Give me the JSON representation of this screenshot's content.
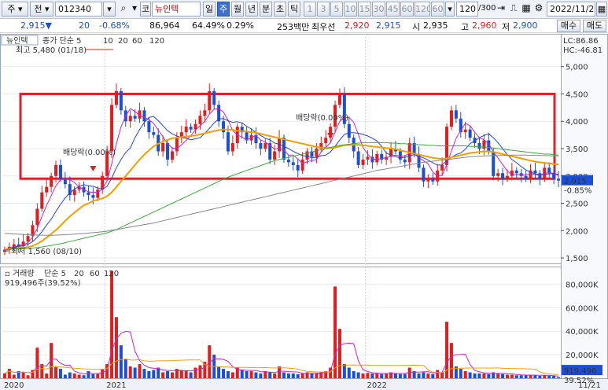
{
  "toolbar": {
    "market": "주",
    "market2": "전",
    "code": "012340",
    "name_prefix": "코",
    "name": "뉴인텍",
    "periods": [
      "일",
      "주",
      "월",
      "년",
      "분",
      "초",
      "틱"
    ],
    "active_period": "주",
    "intervals": [
      "1",
      "3",
      "5",
      "10",
      "15",
      "30",
      "45",
      "60",
      "120",
      "60"
    ],
    "count": "120",
    "total": "/300",
    "date": "2022/11/21",
    "buy_label": "매수",
    "sell_label": "매도"
  },
  "quote": {
    "price": "2,915▼",
    "change": "20",
    "change_pct": "-0.68%",
    "volume": "86,964",
    "vol_ratio": "64.49%",
    "turnover": "0.29%",
    "amount": "253백만",
    "best_ask_label": "최우선",
    "best_ask": "2,920",
    "best_bid": "2,915",
    "open_label": "시",
    "open": "2,935",
    "high_label": "고",
    "high": "2,960",
    "low_label": "저",
    "low": "2,900"
  },
  "colors": {
    "up": "#e01e1e",
    "down": "#1a4fd6",
    "ma5": "#cc22cc",
    "ma10": "#2244dd",
    "ma20": "#f0a000",
    "ma60": "#3aaa3a",
    "ma120": "#888888",
    "highlight_box": "#e0202a"
  },
  "chart_data": [
    {
      "type": "candlestick",
      "title": "뉴인텍",
      "legend": [
        "종가 단순 5",
        "10",
        "20",
        "60",
        "120"
      ],
      "ylim": [
        1400,
        5600
      ],
      "yticks": [
        1500,
        2000,
        2500,
        3000,
        3500,
        4000,
        4500,
        5000
      ],
      "ytick_labels": [
        "1,500",
        "2,000",
        "2,500",
        "3,000",
        "3,500",
        "4,000",
        "4,500",
        "5,000"
      ],
      "x_labels": [
        "2020",
        "2021",
        "2022",
        "11/21"
      ],
      "annotations": {
        "max_label": "최고 5,480 (01/18)",
        "min_label": "최저 1,560 (08/10)",
        "dividend_label_1": "배당락(0.00%)",
        "dividend_label_2": "배당락(0.00%)",
        "lc_label": "LC:86.86",
        "hc_label": "HC:-46.81",
        "last_price": "2,915",
        "last_pct": "-0.85%"
      },
      "highlight_range": [
        2950,
        4500
      ],
      "closes": [
        1650,
        1700,
        1750,
        1720,
        1800,
        1900,
        2100,
        2400,
        2700,
        2800,
        3000,
        3200,
        2950,
        2850,
        2650,
        2750,
        2800,
        2700,
        2650,
        2600,
        2750,
        3000,
        3450,
        4300,
        4550,
        4200,
        4000,
        4100,
        4050,
        4200,
        4000,
        3800,
        3750,
        3450,
        3600,
        3300,
        3450,
        3700,
        3800,
        3900,
        3850,
        3950,
        4100,
        4200,
        4550,
        4300,
        4000,
        3800,
        3450,
        3600,
        3900,
        3800,
        3650,
        3750,
        3600,
        3500,
        3600,
        3300,
        3450,
        3700,
        3300,
        3250,
        3200,
        3100,
        3300,
        3450,
        3350,
        3500,
        3600,
        3700,
        3900,
        4300,
        4500,
        3950,
        3700,
        3450,
        3200,
        3300,
        3350,
        3250,
        3400,
        3300,
        3350,
        3500,
        3450,
        3300,
        3250,
        3600,
        3400,
        3150,
        2900,
        2950,
        2900,
        3100,
        3200,
        3900,
        4200,
        4050,
        3800,
        3850,
        3700,
        3600,
        3500,
        3650,
        3450,
        3000,
        3050,
        2950,
        3000,
        3100,
        3050,
        3000,
        2950,
        3100,
        3050,
        2950,
        3150,
        3050,
        2950,
        2915
      ],
      "series": [
        {
          "name": "5",
          "values": [
            1650,
            1680,
            1700,
            1720,
            1740,
            1780,
            1880,
            2040,
            2260,
            2460,
            2640,
            2820,
            2930,
            2950,
            2930,
            2880,
            2800,
            2750,
            2710,
            2700,
            2700,
            2760,
            2910,
            3220,
            3590,
            3900,
            4100,
            4230,
            4180,
            4110,
            4070,
            4030,
            3960,
            3840,
            3720,
            3590,
            3510,
            3500,
            3570,
            3650,
            3740,
            3840,
            3920,
            4000,
            4130,
            4220,
            4230,
            4170,
            4020,
            3830,
            3750,
            3710,
            3660,
            3700,
            3740,
            3660,
            3620,
            3560,
            3490,
            3510,
            3470,
            3380,
            3380,
            3310,
            3230,
            3260,
            3280,
            3300,
            3440,
            3520,
            3610,
            3800,
            4000,
            4070,
            4070,
            3980,
            3760,
            3520,
            3400,
            3310,
            3300,
            3320,
            3330,
            3360,
            3380,
            3360,
            3370,
            3420,
            3400,
            3340,
            3280,
            3220,
            3070,
            3000,
            3010,
            3210,
            3460,
            3690,
            3830,
            3960,
            3920,
            3800,
            3700,
            3660,
            3590,
            3440,
            3330,
            3210,
            3090,
            3020,
            3030,
            3020,
            3020,
            3040,
            3030,
            3010,
            3050,
            3060,
            3050,
            3010
          ]
        },
        {
          "name": "10",
          "values": [
            1650,
            1670,
            1690,
            1710,
            1720,
            1750,
            1800,
            1880,
            1980,
            2100,
            2210,
            2350,
            2480,
            2600,
            2690,
            2760,
            2810,
            2840,
            2820,
            2810,
            2780,
            2760,
            2810,
            2960,
            3150,
            3300,
            3430,
            3510,
            3700,
            3850,
            3980,
            4070,
            4090,
            4010,
            3920,
            3830,
            3770,
            3730,
            3700,
            3690,
            3660,
            3680,
            3700,
            3780,
            3870,
            3970,
            4040,
            4050,
            4010,
            3980,
            3990,
            3970,
            3910,
            3860,
            3790,
            3740,
            3690,
            3660,
            3600,
            3580,
            3540,
            3500,
            3450,
            3410,
            3370,
            3360,
            3330,
            3340,
            3370,
            3380,
            3440,
            3540,
            3660,
            3760,
            3790,
            3790,
            3780,
            3760,
            3730,
            3690,
            3640,
            3540,
            3420,
            3380,
            3350,
            3330,
            3340,
            3370,
            3390,
            3360,
            3330,
            3290,
            3240,
            3200,
            3200,
            3280,
            3340,
            3390,
            3420,
            3490,
            3590,
            3640,
            3700,
            3740,
            3770,
            3700,
            3610,
            3500,
            3390,
            3300,
            3240,
            3170,
            3110,
            3070,
            3040,
            3020,
            3030,
            3040,
            3040,
            3030
          ]
        },
        {
          "name": "20",
          "values": [
            1650,
            1660,
            1670,
            1680,
            1690,
            1700,
            1720,
            1760,
            1810,
            1870,
            1940,
            2010,
            2090,
            2180,
            2260,
            2330,
            2400,
            2460,
            2500,
            2540,
            2570,
            2590,
            2630,
            2700,
            2800,
            2900,
            3000,
            3100,
            3200,
            3300,
            3390,
            3470,
            3540,
            3590,
            3630,
            3660,
            3690,
            3700,
            3710,
            3720,
            3730,
            3740,
            3760,
            3780,
            3800,
            3820,
            3840,
            3850,
            3850,
            3840,
            3830,
            3820,
            3810,
            3800,
            3790,
            3770,
            3750,
            3730,
            3710,
            3690,
            3670,
            3650,
            3630,
            3610,
            3590,
            3570,
            3550,
            3530,
            3520,
            3510,
            3510,
            3520,
            3540,
            3560,
            3570,
            3570,
            3570,
            3560,
            3550,
            3540,
            3530,
            3520,
            3510,
            3500,
            3490,
            3470,
            3450,
            3430,
            3410,
            3390,
            3370,
            3350,
            3330,
            3320,
            3310,
            3320,
            3340,
            3360,
            3380,
            3400,
            3420,
            3430,
            3440,
            3450,
            3450,
            3440,
            3420,
            3400,
            3380,
            3360,
            3340,
            3320,
            3300,
            3280,
            3260,
            3250,
            3240,
            3230,
            3220,
            3210
          ]
        },
        {
          "name": "60",
          "values": [
            1650,
            1655,
            1660,
            1665,
            1670,
            1675,
            1680,
            1690,
            1700,
            1715,
            1730,
            1745,
            1760,
            1780,
            1800,
            1820,
            1840,
            1860,
            1880,
            1900,
            1920,
            1940,
            1960,
            1990,
            2020,
            2060,
            2100,
            2140,
            2180,
            2220,
            2260,
            2300,
            2340,
            2380,
            2420,
            2460,
            2500,
            2540,
            2580,
            2620,
            2660,
            2700,
            2740,
            2780,
            2820,
            2860,
            2900,
            2940,
            2980,
            3010,
            3040,
            3070,
            3100,
            3130,
            3160,
            3190,
            3220,
            3250,
            3280,
            3300,
            3320,
            3340,
            3360,
            3380,
            3400,
            3420,
            3440,
            3460,
            3480,
            3500,
            3520,
            3540,
            3560,
            3570,
            3580,
            3590,
            3600,
            3610,
            3610,
            3610,
            3610,
            3610,
            3610,
            3600,
            3600,
            3590,
            3590,
            3580,
            3580,
            3570,
            3570,
            3560,
            3560,
            3550,
            3550,
            3550,
            3550,
            3550,
            3550,
            3550,
            3540,
            3540,
            3530,
            3530,
            3520,
            3510,
            3500,
            3490,
            3480,
            3470,
            3460,
            3450,
            3440,
            3430,
            3420,
            3410,
            3400,
            3400,
            3390,
            3380
          ]
        },
        {
          "name": "120",
          "values": [
            1950,
            1945,
            1940,
            1935,
            1930,
            1925,
            1920,
            1918,
            1916,
            1915,
            1915,
            1918,
            1922,
            1926,
            1930,
            1936,
            1942,
            1948,
            1955,
            1962,
            1970,
            1980,
            1990,
            2005,
            2020,
            2035,
            2050,
            2065,
            2080,
            2095,
            2110,
            2125,
            2140,
            2160,
            2180,
            2200,
            2220,
            2240,
            2260,
            2280,
            2300,
            2320,
            2340,
            2360,
            2380,
            2400,
            2420,
            2440,
            2460,
            2480,
            2500,
            2520,
            2540,
            2560,
            2580,
            2600,
            2620,
            2640,
            2660,
            2680,
            2700,
            2720,
            2740,
            2760,
            2780,
            2800,
            2820,
            2840,
            2860,
            2880,
            2900,
            2920,
            2940,
            2960,
            2980,
            3000,
            3020,
            3040,
            3060,
            3080,
            3100,
            3115,
            3130,
            3145,
            3160,
            3175,
            3190,
            3205,
            3220,
            3235,
            3250,
            3260,
            3270,
            3280,
            3290,
            3300,
            3310,
            3320,
            3330,
            3340,
            3350,
            3355,
            3360,
            3365,
            3370,
            3372,
            3374,
            3376,
            3378,
            3380,
            3380,
            3380,
            3380,
            3378,
            3376,
            3374,
            3372,
            3370,
            3368,
            3365
          ]
        }
      ]
    },
    {
      "type": "bar",
      "title": "거래량",
      "legend": [
        "거래량",
        "단순 5",
        "20",
        "60",
        "120"
      ],
      "info": "919,496주(39.52%)",
      "ylim": [
        0,
        95000
      ],
      "yticks": [
        20000,
        40000,
        60000,
        80000
      ],
      "ytick_labels": [
        "20,000K",
        "40,000K",
        "60,000K",
        "80,000K"
      ],
      "last_value": "919,496",
      "last_pct": "39.52%",
      "values": [
        4000,
        8000,
        3000,
        6000,
        5000,
        2500,
        7000,
        26000,
        12000,
        4000,
        30000,
        10000,
        8000,
        3000,
        5000,
        4000,
        3000,
        2500,
        6000,
        3500,
        4000,
        8000,
        12000,
        91000,
        52000,
        28000,
        16000,
        10000,
        9000,
        12000,
        8000,
        6000,
        7000,
        9000,
        5000,
        6000,
        5000,
        8000,
        7000,
        6000,
        5000,
        9000,
        11000,
        14000,
        28000,
        20000,
        10000,
        8000,
        6000,
        5000,
        9000,
        7000,
        6000,
        6000,
        5000,
        4000,
        6000,
        5000,
        4000,
        10000,
        5000,
        4000,
        4000,
        3500,
        4000,
        5000,
        4000,
        4500,
        5000,
        6000,
        9000,
        78000,
        42000,
        12000,
        9000,
        6000,
        5000,
        4000,
        4500,
        4000,
        4000,
        3500,
        4000,
        5000,
        4000,
        3500,
        3500,
        9000,
        6000,
        4000,
        5000,
        4000,
        3500,
        7000,
        5000,
        48000,
        30000,
        10000,
        8000,
        6000,
        5000,
        4000,
        4000,
        4000,
        3500,
        5000,
        4000,
        3500,
        3000,
        3000,
        2500,
        2500,
        2500,
        3000,
        2500,
        2000,
        2500,
        2000,
        2000,
        919
      ]
    }
  ]
}
